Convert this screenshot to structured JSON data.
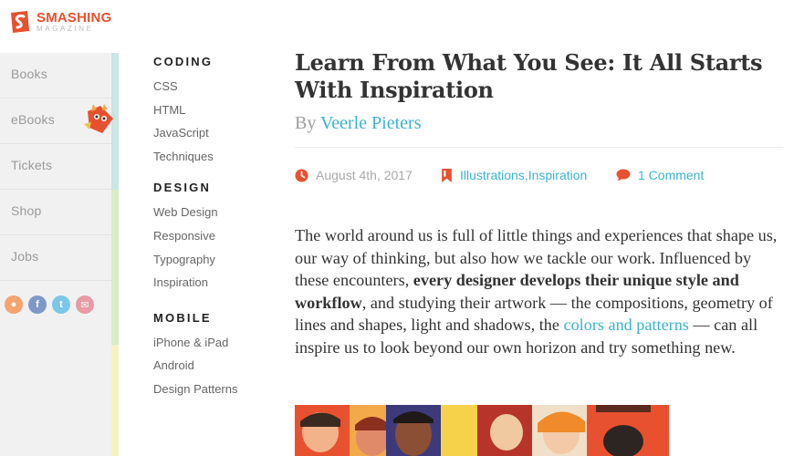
{
  "brand": {
    "name": "SMASHING",
    "sub": "MAGAZINE",
    "accent": "#e8512f"
  },
  "rail": {
    "items": [
      {
        "label": "Books"
      },
      {
        "label": "eBooks"
      },
      {
        "label": "Tickets"
      },
      {
        "label": "Shop"
      },
      {
        "label": "Jobs"
      }
    ],
    "social": [
      {
        "icon": "rss-icon",
        "glyph": "●",
        "color": "#f5a36f"
      },
      {
        "icon": "facebook-icon",
        "glyph": "f",
        "color": "#7e98c7"
      },
      {
        "icon": "twitter-icon",
        "glyph": "t",
        "color": "#7cc7e9"
      },
      {
        "icon": "email-icon",
        "glyph": "✉",
        "color": "#e99aa5"
      }
    ]
  },
  "categories": [
    {
      "heading": "CODING",
      "links": [
        "CSS",
        "HTML",
        "JavaScript",
        "Techniques"
      ]
    },
    {
      "heading": "DESIGN",
      "links": [
        "Web Design",
        "Responsive",
        "Typography",
        "Inspiration"
      ]
    },
    {
      "heading": "MOBILE",
      "links": [
        "iPhone & iPad",
        "Android",
        "Design Patterns"
      ]
    }
  ],
  "article": {
    "title_line1": "Learn From What You See: It All Starts",
    "title_line2": "With Inspiration",
    "by": "By",
    "author": "Veerle Pieters",
    "date": "August 4th, 2017",
    "tag1": "Illustrations",
    "tag_sep": ", ",
    "tag2": "Inspiration",
    "comments": "1 Comment",
    "p_part1": "The world around us is full of little things and experiences that shape us, our way of thinking, but also how we tackle our work. Influenced by these encounters, ",
    "p_bold": "every designer develops their unique style and workflow",
    "p_part2": ", and studying their artwork — the compositions, geometry of lines and shapes, light and shadows, the ",
    "p_link": "colors and patterns",
    "p_part3": " — can all inspire us to look beyond our own horizon and try something new."
  }
}
